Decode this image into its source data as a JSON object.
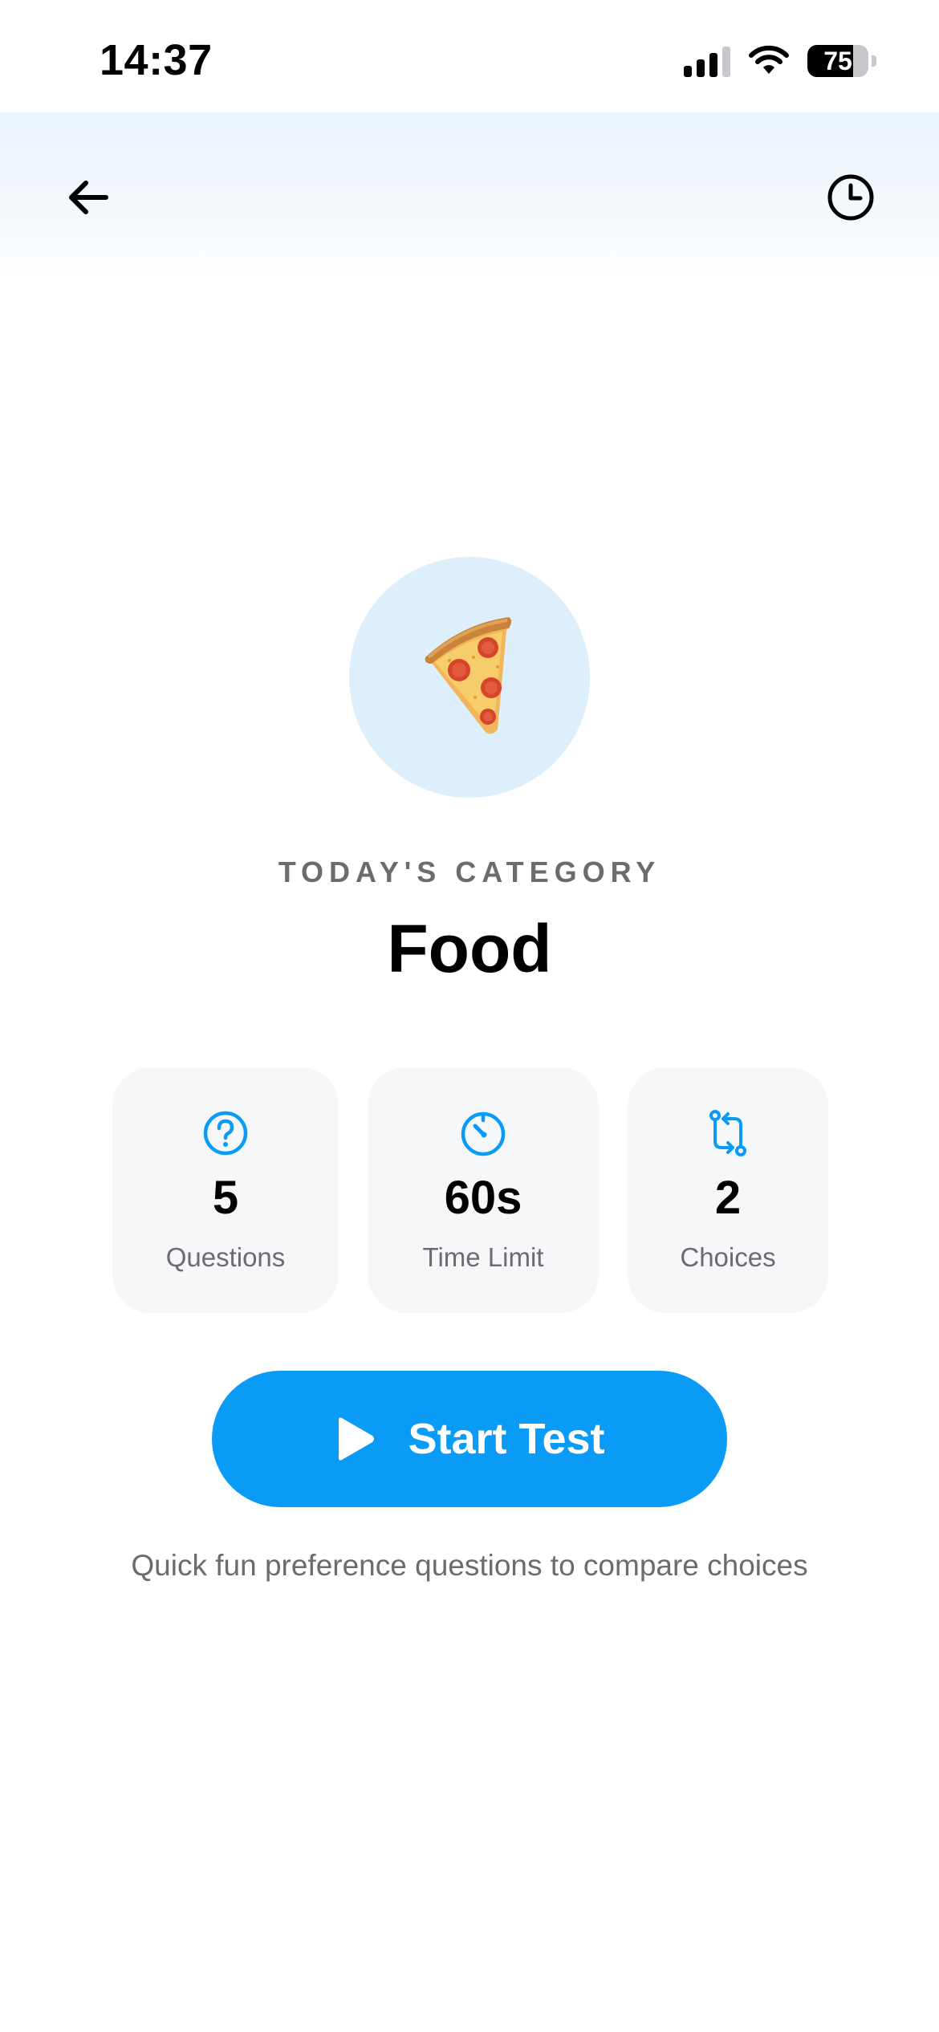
{
  "status_bar": {
    "time": "14:37",
    "battery_percent": "75",
    "battery_level": 0.75,
    "icons": [
      "cellular-signal-icon",
      "wifi-icon",
      "battery-icon"
    ]
  },
  "header": {
    "back_icon": "arrow-left-icon",
    "history_icon": "clock-icon"
  },
  "category": {
    "emoji_icon": "pizza-emoji",
    "label": "TODAY'S CATEGORY",
    "title": "Food"
  },
  "stats": [
    {
      "icon": "question-circle-icon",
      "value": "5",
      "label": "Questions"
    },
    {
      "icon": "timer-icon",
      "value": "60s",
      "label": "Time Limit"
    },
    {
      "icon": "compare-arrows-icon",
      "value": "2",
      "label": "Choices"
    }
  ],
  "start_button": {
    "icon": "play-icon",
    "label": "Start Test"
  },
  "subtitle": "Quick fun preference questions to compare choices",
  "colors": {
    "accent": "#0A9BF7",
    "header_gradient_top": "#E9F4FD",
    "hero_circle": "#DDEFFB",
    "card_background": "#F6F7F9",
    "muted_text": "#6B6B70"
  }
}
